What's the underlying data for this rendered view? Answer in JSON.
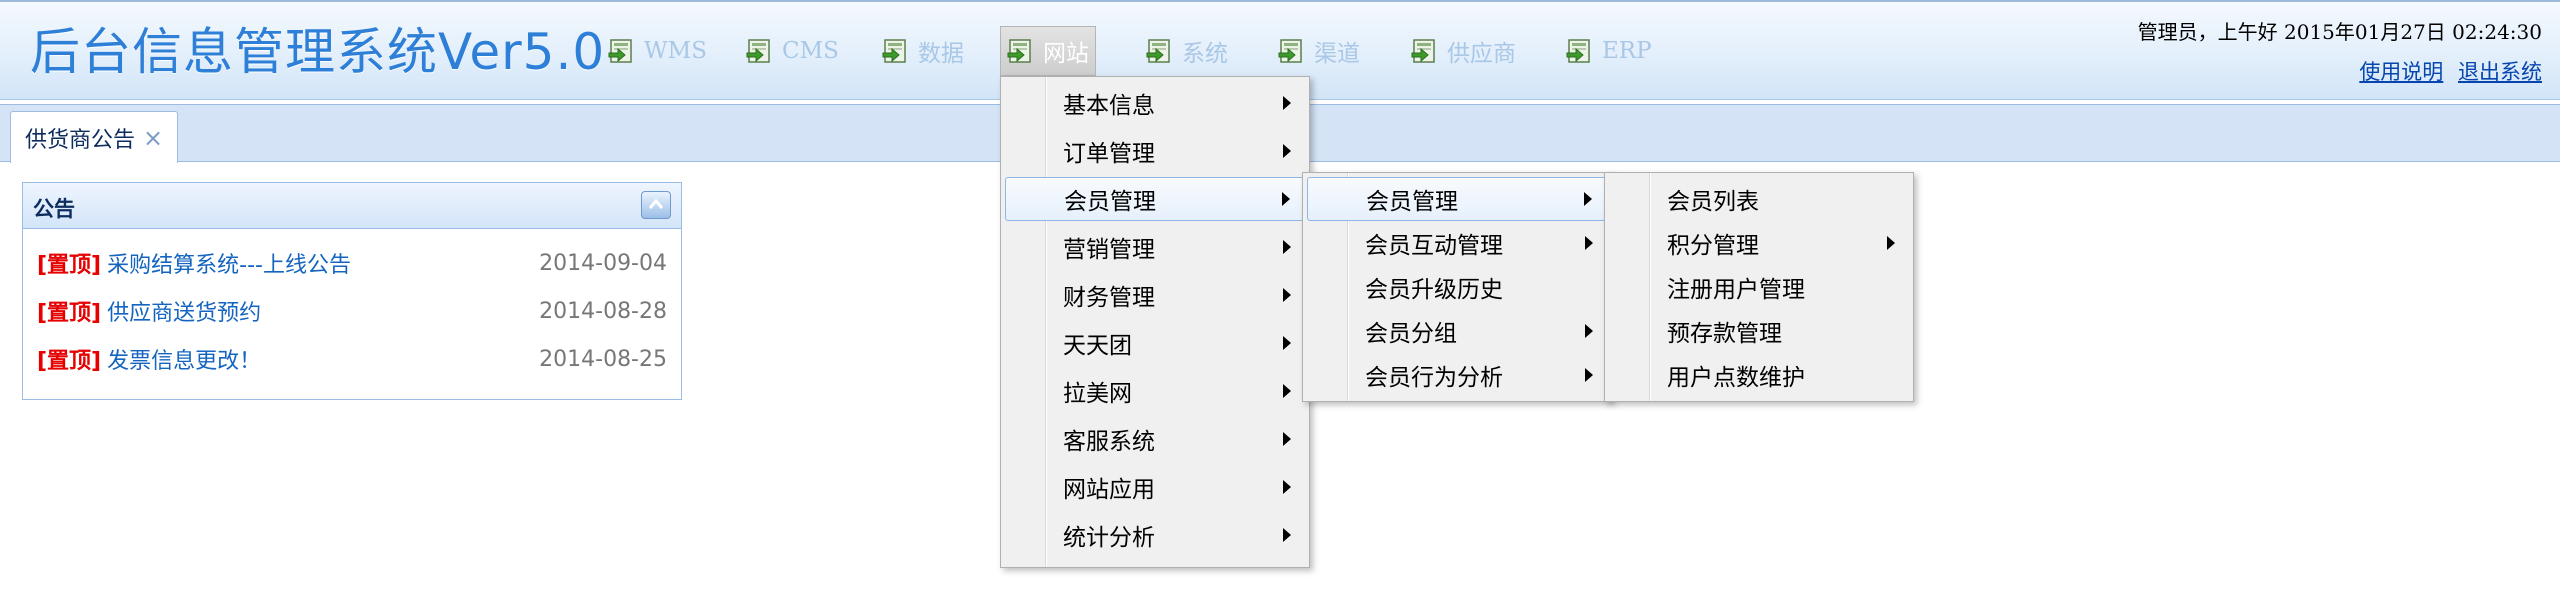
{
  "header": {
    "title": "后台信息管理系统Ver5.0",
    "greeting": "管理员，上午好 2015年01月27日 02:24:30",
    "links": {
      "help": "使用说明",
      "logout": "退出系统"
    }
  },
  "topnav": [
    {
      "label": "WMS",
      "icon": "module-icon"
    },
    {
      "label": "CMS",
      "icon": "module-icon"
    },
    {
      "label": "数据",
      "icon": "module-icon"
    },
    {
      "label": "网站",
      "icon": "module-icon",
      "active": true
    },
    {
      "label": "系统",
      "icon": "module-icon"
    },
    {
      "label": "渠道",
      "icon": "module-icon"
    },
    {
      "label": "供应商",
      "icon": "module-icon"
    },
    {
      "label": "ERP",
      "icon": "module-icon"
    }
  ],
  "tabs": [
    {
      "label": "供货商公告",
      "close": "×"
    }
  ],
  "notice": {
    "title": "公告",
    "pin_label": "[置顶]",
    "items": [
      {
        "text": "采购结算系统---上线公告",
        "date": "2014-09-04"
      },
      {
        "text": "供应商送货预约",
        "date": "2014-08-28"
      },
      {
        "text": "发票信息更改！",
        "date": "2014-08-25"
      }
    ]
  },
  "menus": {
    "website": [
      {
        "label": "基本信息",
        "submenu": true
      },
      {
        "label": "订单管理",
        "submenu": true
      },
      {
        "label": "会员管理",
        "submenu": true,
        "highlighted": true
      },
      {
        "label": "营销管理",
        "submenu": true
      },
      {
        "label": "财务管理",
        "submenu": true
      },
      {
        "label": "天天团",
        "submenu": true
      },
      {
        "label": "拉美网",
        "submenu": true
      },
      {
        "label": "客服系统",
        "submenu": true
      },
      {
        "label": "网站应用",
        "submenu": true
      },
      {
        "label": "统计分析",
        "submenu": true
      }
    ],
    "member": [
      {
        "label": "会员管理",
        "submenu": true,
        "highlighted": true
      },
      {
        "label": "会员互动管理",
        "submenu": true
      },
      {
        "label": "会员升级历史",
        "submenu": false
      },
      {
        "label": "会员分组",
        "submenu": true
      },
      {
        "label": "会员行为分析",
        "submenu": true
      }
    ],
    "member_sub": [
      {
        "label": "会员列表",
        "submenu": false
      },
      {
        "label": "积分管理",
        "submenu": true
      },
      {
        "label": "注册用户管理",
        "submenu": false
      },
      {
        "label": "预存款管理",
        "submenu": false
      },
      {
        "label": "用户点数维护",
        "submenu": false
      }
    ]
  },
  "colors": {
    "title": "#2d7fd7",
    "header_bg": "#e3effb",
    "pin": "#e60000",
    "link": "#1565c0",
    "menu_bg": "#f0f0f0"
  }
}
